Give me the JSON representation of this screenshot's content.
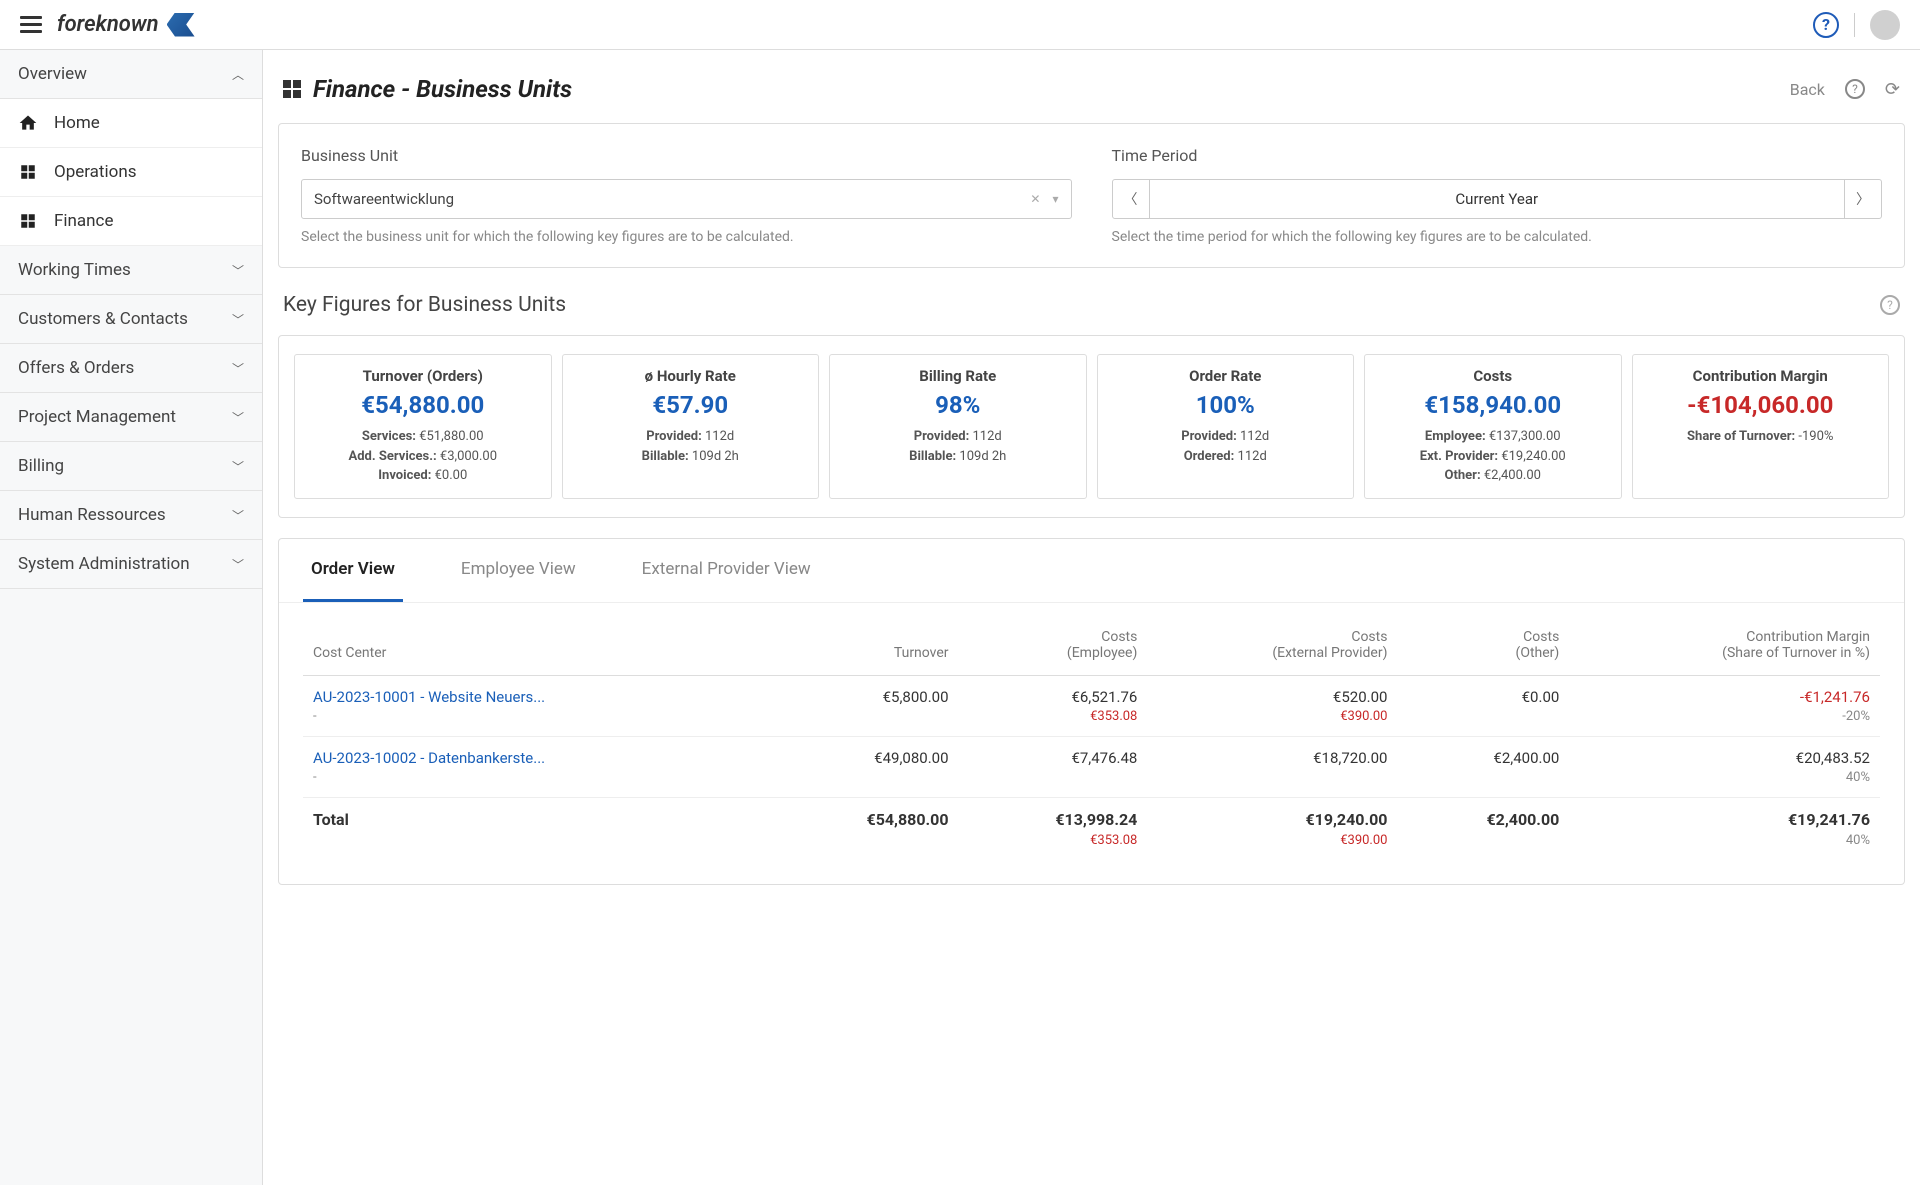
{
  "brand": "foreknown",
  "sidebar": {
    "overview": {
      "label": "Overview",
      "items": [
        {
          "label": "Home"
        },
        {
          "label": "Operations"
        },
        {
          "label": "Finance"
        }
      ]
    },
    "groups": [
      {
        "label": "Working Times"
      },
      {
        "label": "Customers & Contacts"
      },
      {
        "label": "Offers & Orders"
      },
      {
        "label": "Project Management"
      },
      {
        "label": "Billing"
      },
      {
        "label": "Human Ressources"
      },
      {
        "label": "System Administration"
      }
    ]
  },
  "page": {
    "title": "Finance - Business Units",
    "back": "Back"
  },
  "filters": {
    "bu_label": "Business Unit",
    "bu_value": "Softwareentwicklung",
    "bu_help": "Select the business unit for which the following key figures are to be calculated.",
    "period_label": "Time Period",
    "period_value": "Current Year",
    "period_help": "Select the time period for which the following key figures are to be calculated."
  },
  "kpi_section_title": "Key Figures for Business Units",
  "kpis": {
    "turnover": {
      "title": "Turnover (Orders)",
      "value": "€54,880.00",
      "l1a": "Services:",
      "l1b": " €51,880.00",
      "l2a": "Add. Services.:",
      "l2b": " €3,000.00",
      "l3a": "Invoiced:",
      "l3b": " €0.00"
    },
    "hourly": {
      "title": "ø Hourly Rate",
      "value": "€57.90",
      "l1a": "Provided:",
      "l1b": " 112d",
      "l2a": "Billable:",
      "l2b": " 109d 2h"
    },
    "billing": {
      "title": "Billing Rate",
      "value": "98%",
      "l1a": "Provided:",
      "l1b": " 112d",
      "l2a": "Billable:",
      "l2b": " 109d 2h"
    },
    "order": {
      "title": "Order Rate",
      "value": "100%",
      "l1a": "Provided:",
      "l1b": " 112d",
      "l2a": "Ordered:",
      "l2b": " 112d"
    },
    "costs": {
      "title": "Costs",
      "value": "€158,940.00",
      "l1a": "Employee:",
      "l1b": " €137,300.00",
      "l2a": "Ext. Provider:",
      "l2b": " €19,240.00",
      "l3a": "Other:",
      "l3b": " €2,400.00"
    },
    "margin": {
      "title": "Contribution Margin",
      "value": "-€104,060.00",
      "l1a": "Share of Turnover:",
      "l1b": " -190%"
    }
  },
  "tabs": {
    "order": "Order View",
    "employee": "Employee View",
    "external": "External Provider View"
  },
  "table": {
    "headers": {
      "cost_center": "Cost Center",
      "turnover": "Turnover",
      "costs_emp_l1": "Costs",
      "costs_emp_l2": "(Employee)",
      "costs_ext_l1": "Costs",
      "costs_ext_l2": "(External Provider)",
      "costs_other_l1": "Costs",
      "costs_other_l2": "(Other)",
      "margin_l1": "Contribution Margin",
      "margin_l2": "(Share of Turnover in %)"
    },
    "rows": [
      {
        "name": "AU-2023-10001 - Website Neuers...",
        "sub": "-",
        "turnover": "€5,800.00",
        "costs_emp": "€6,521.76",
        "costs_emp_sub": "€353.08",
        "costs_ext": "€520.00",
        "costs_ext_sub": "€390.00",
        "costs_other": "€0.00",
        "margin": "-€1,241.76",
        "margin_neg": true,
        "margin_sub": "-20%"
      },
      {
        "name": "AU-2023-10002 - Datenbankerste...",
        "sub": "-",
        "turnover": "€49,080.00",
        "costs_emp": "€7,476.48",
        "costs_emp_sub": "",
        "costs_ext": "€18,720.00",
        "costs_ext_sub": "",
        "costs_other": "€2,400.00",
        "margin": "€20,483.52",
        "margin_neg": false,
        "margin_sub": "40%"
      }
    ],
    "total": {
      "label": "Total",
      "turnover": "€54,880.00",
      "costs_emp": "€13,998.24",
      "costs_emp_sub": "€353.08",
      "costs_ext": "€19,240.00",
      "costs_ext_sub": "€390.00",
      "costs_other": "€2,400.00",
      "margin": "€19,241.76",
      "margin_sub": "40%"
    }
  }
}
